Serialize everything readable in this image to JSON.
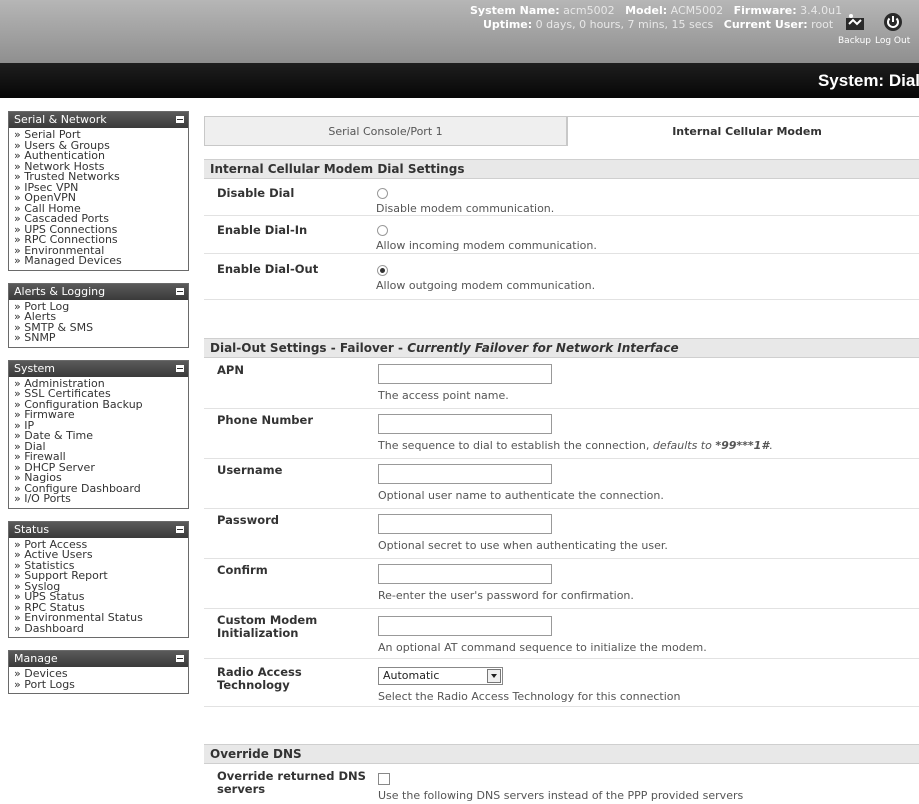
{
  "header": {
    "system_name_label": "System Name:",
    "system_name": "acm5002",
    "model_label": "Model:",
    "model": "ACM5002",
    "firmware_label": "Firmware:",
    "firmware": "3.4.0u1",
    "uptime_label": "Uptime:",
    "uptime": "0 days, 0 hours, 7 mins, 15 secs",
    "current_user_label": "Current User:",
    "current_user": "root",
    "backup_label": "Backup",
    "logout_label": "Log Out",
    "page_title": "System: Dial"
  },
  "sidebar": {
    "serial_network": {
      "title": "Serial & Network",
      "items": [
        "» Serial Port",
        "» Users & Groups",
        "» Authentication",
        "» Network Hosts",
        "» Trusted Networks",
        "» IPsec VPN",
        "» OpenVPN",
        "» Call Home",
        "» Cascaded Ports",
        "» UPS Connections",
        "» RPC Connections",
        "» Environmental",
        "» Managed Devices"
      ]
    },
    "alerts_logging": {
      "title": "Alerts & Logging",
      "items": [
        "» Port Log",
        "» Alerts",
        "» SMTP & SMS",
        "» SNMP"
      ]
    },
    "system": {
      "title": "System",
      "items": [
        "» Administration",
        "» SSL Certificates",
        "» Configuration Backup",
        "» Firmware",
        "» IP",
        "» Date & Time",
        "» Dial",
        "» Firewall",
        "» DHCP Server",
        "» Nagios",
        "» Configure Dashboard",
        "» I/O Ports"
      ]
    },
    "status": {
      "title": "Status",
      "items": [
        "» Port Access",
        "» Active Users",
        "» Statistics",
        "» Support Report",
        "» Syslog",
        "» UPS Status",
        "» RPC Status",
        "» Environmental Status",
        "» Dashboard"
      ]
    },
    "manage": {
      "title": "Manage",
      "items": [
        "» Devices",
        "» Port Logs"
      ]
    }
  },
  "tabs": {
    "serial_console": "Serial Console/Port 1",
    "internal_modem": "Internal Cellular Modem"
  },
  "dial_settings": {
    "title": "Internal Cellular Modem Dial Settings",
    "disable": {
      "label": "Disable Dial",
      "desc": "Disable modem communication.",
      "selected": false
    },
    "dial_in": {
      "label": "Enable Dial-In",
      "desc": "Allow incoming modem communication.",
      "selected": false
    },
    "dial_out": {
      "label": "Enable Dial-Out",
      "desc": "Allow outgoing modem communication.",
      "selected": true
    }
  },
  "dialout": {
    "title_main": "Dial-Out Settings - Failover - ",
    "title_italic": "Currently Failover for Network Interface",
    "apn": {
      "label": "APN",
      "value": "",
      "desc": "The access point name."
    },
    "phone": {
      "label": "Phone Number",
      "value": "",
      "desc_main": "The sequence to dial to establish the connection, ",
      "desc_italic": "defaults to ",
      "desc_bold": "*99***1#",
      "desc_end": "."
    },
    "username": {
      "label": "Username",
      "value": "",
      "desc": "Optional user name to authenticate the connection."
    },
    "password": {
      "label": "Password",
      "value": "",
      "desc": "Optional secret to use when authenticating the user."
    },
    "confirm": {
      "label": "Confirm",
      "value": "",
      "desc": "Re-enter the user's password for confirmation."
    },
    "custom_init": {
      "label_line1": "Custom Modem",
      "label_line2": "Initialization",
      "value": "",
      "desc": "An optional AT command sequence to initialize the modem."
    },
    "radio_tech": {
      "label_line1": "Radio Access",
      "label_line2": "Technology",
      "value": "Automatic",
      "desc": "Select the Radio Access Technology for this connection"
    }
  },
  "override_dns": {
    "title": "Override DNS",
    "label_line1": "Override returned DNS",
    "label_line2": "servers",
    "checked": false,
    "desc": "Use the following DNS servers instead of the PPP provided servers"
  }
}
